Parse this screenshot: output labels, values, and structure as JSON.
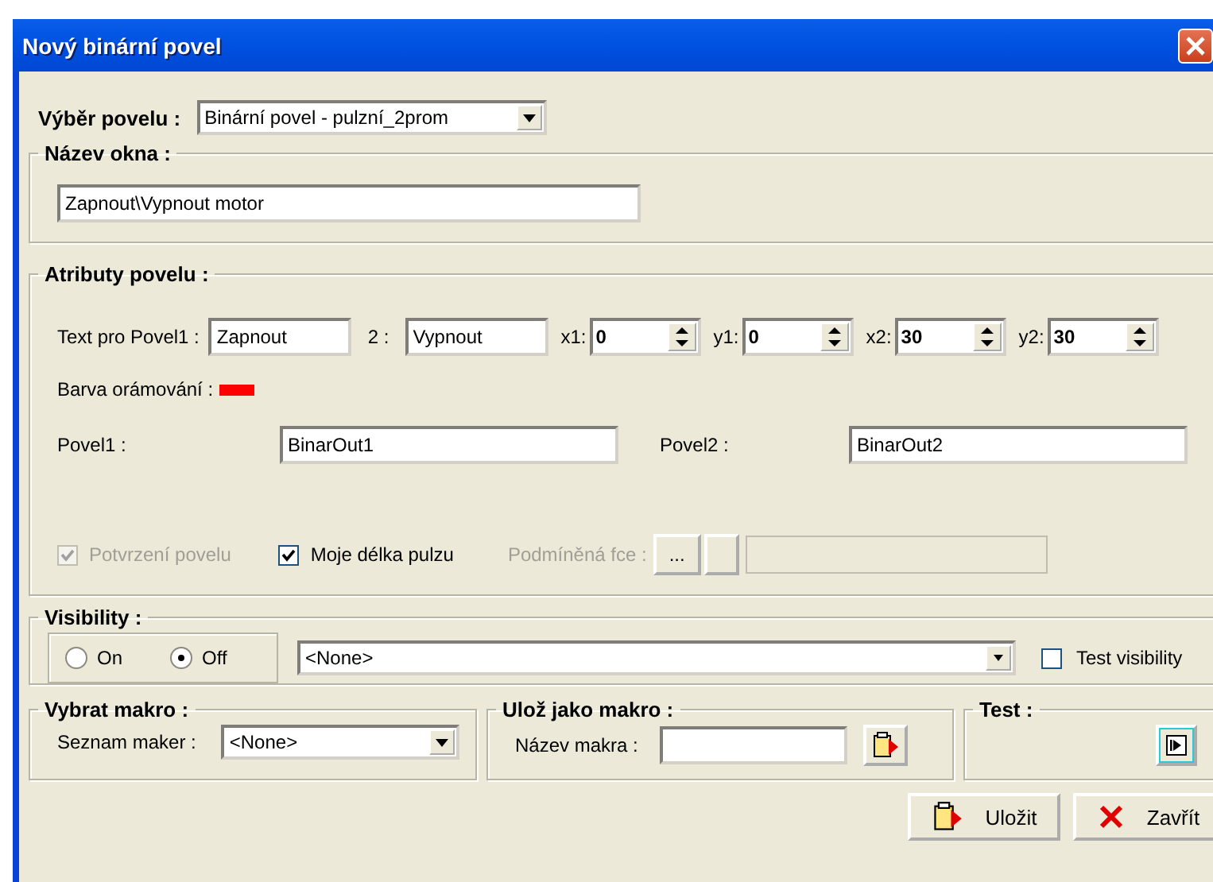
{
  "window": {
    "title": "Nový binární povel"
  },
  "command_select": {
    "label": "Výběr povelu :",
    "value": "Binární povel - pulzní_2prom"
  },
  "window_name": {
    "legend": "Název okna :",
    "value": "Zapnout\\Vypnout motor"
  },
  "attributes": {
    "legend": "Atributy povelu :",
    "text_fields": [
      {
        "label": "Text pro Povel1 :",
        "value": "Zapnout"
      },
      {
        "label": "2 :",
        "value": "Vypnout"
      }
    ],
    "spinners": [
      {
        "label": "x1:",
        "value": "0"
      },
      {
        "label": "y1:",
        "value": "0"
      },
      {
        "label": "x2:",
        "value": "30"
      },
      {
        "label": "y2:",
        "value": "30"
      }
    ],
    "border_color": {
      "label": "Barva orámování :",
      "color": "#ff0000"
    },
    "commands": [
      {
        "label": "Povel1 :",
        "value": "BinarOut1"
      },
      {
        "label": "Povel2 :",
        "value": "BinarOut2"
      }
    ],
    "options": [
      {
        "label": "Potvrzení povelu",
        "checked": true,
        "disabled": true
      },
      {
        "label": "Moje délka pulzu",
        "checked": true,
        "disabled": false
      }
    ],
    "conditional": {
      "label": "Podmíněná fce :",
      "button": "...",
      "disabled": true
    }
  },
  "visibility": {
    "legend": "Visibility :",
    "radios": [
      {
        "label": "On",
        "selected": false
      },
      {
        "label": "Off",
        "selected": true
      }
    ],
    "value": "<None>",
    "test": {
      "label": "Test visibility",
      "checked": false
    }
  },
  "macro_select": {
    "legend": "Vybrat makro :",
    "label": "Seznam maker :",
    "value": "<None>"
  },
  "macro_save": {
    "legend": "Ulož jako makro :",
    "label": "Název makra :"
  },
  "test": {
    "legend": "Test :"
  },
  "buttons": [
    {
      "kind": "save",
      "label": "Uložit"
    },
    {
      "kind": "close",
      "label": "Zavřít"
    }
  ]
}
